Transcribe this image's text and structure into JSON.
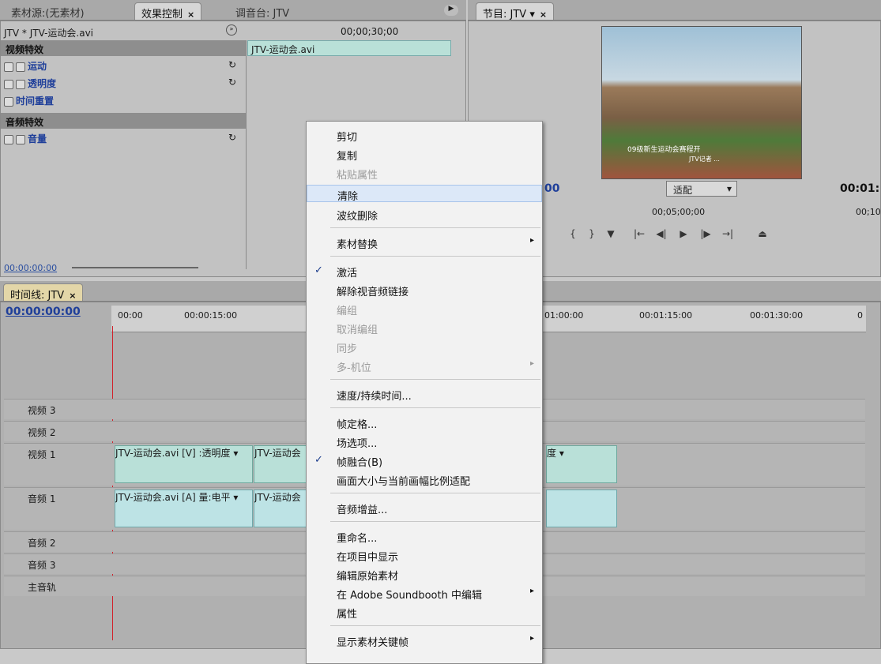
{
  "tabs_top_left": [
    {
      "label": "素材源:(无素材)"
    },
    {
      "label": "效果控制",
      "close": "×"
    },
    {
      "label": "调音台: JTV"
    }
  ],
  "program_tab": {
    "label": "节目: JTV",
    "close": "×"
  },
  "effect_controls": {
    "clip_path": "JTV * JTV-运动会.avi",
    "timecode_ruler": "00;00;30;00",
    "clip_name": "JTV-运动会.avi",
    "video_effects": "视频特效",
    "audio_effects": "音频特效",
    "items": [
      {
        "label": "运动"
      },
      {
        "label": "透明度"
      },
      {
        "label": "时间重置"
      }
    ],
    "audio_items": [
      {
        "label": "音量"
      }
    ],
    "footer_time": "00:00:00:00"
  },
  "program": {
    "timecode_left": "00",
    "fit_label": "适配",
    "timecode_right": "00:01:",
    "ruler_mid": "00;05;00;00",
    "ruler_right": "00;10",
    "frame_caption": "09级新生运动会赛程开",
    "frame_caption2": "JTV记者 ..."
  },
  "timeline": {
    "tab": "时间线: JTV",
    "close": "×",
    "timecode": "00:00:00:00",
    "ruler": [
      "00:00",
      "00:00:15:00",
      "01:00:00",
      "00:01:15:00",
      "00:01:30:00",
      "0"
    ],
    "tracks": [
      {
        "label": "视频 3"
      },
      {
        "label": "视频 2"
      },
      {
        "label": "视频 1"
      },
      {
        "label": "音频 1"
      },
      {
        "label": "音频 2"
      },
      {
        "label": "音频 3"
      },
      {
        "label": "主音轨"
      }
    ],
    "v1_clip": "JTV-运动会.avi [V] :透明度 ▾",
    "v1_clip2": "JTV-运动会",
    "v1_clip3": "度 ▾",
    "a1_clip": "JTV-运动会.avi [A] 量:电平 ▾",
    "a1_clip2": "JTV-运动会"
  },
  "context_menu": {
    "items": [
      {
        "label": "剪切"
      },
      {
        "label": "复制"
      },
      {
        "label": "粘贴属性"
      },
      {
        "label": "清除"
      },
      {
        "label": "波纹删除"
      },
      {
        "label": "素材替换"
      },
      {
        "label": "激活"
      },
      {
        "label": "解除视音频链接"
      },
      {
        "label": "编组"
      },
      {
        "label": "取消编组"
      },
      {
        "label": "同步"
      },
      {
        "label": "多-机位"
      },
      {
        "label": "速度/持续时间..."
      },
      {
        "label": "帧定格..."
      },
      {
        "label": "场选项..."
      },
      {
        "label": "帧融合(B)"
      },
      {
        "label": "画面大小与当前画幅比例适配"
      },
      {
        "label": "音频增益..."
      },
      {
        "label": "重命名..."
      },
      {
        "label": "在项目中显示"
      },
      {
        "label": "编辑原始素材"
      },
      {
        "label": "在 Adobe Soundbooth 中编辑"
      },
      {
        "label": "属性"
      },
      {
        "label": "显示素材关键帧"
      }
    ],
    "check": "✓",
    "arrow": "▸"
  }
}
